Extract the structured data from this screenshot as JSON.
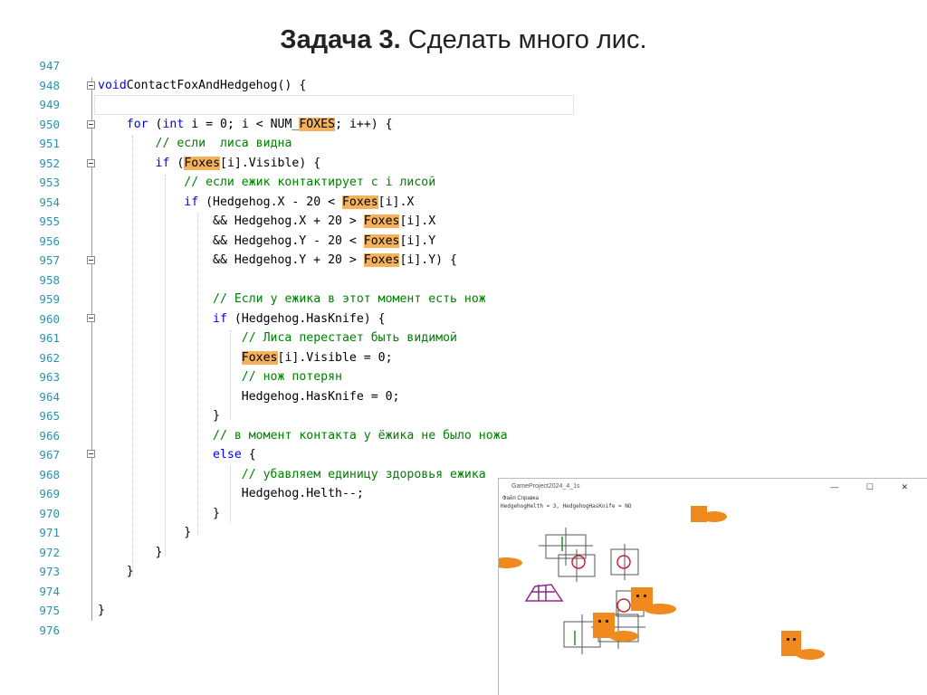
{
  "slide": {
    "title_bold": "Задача 3.",
    "title_rest": " Сделать много лис."
  },
  "editor": {
    "lines": [
      {
        "no": "947",
        "parts": []
      },
      {
        "no": "948",
        "parts": [
          [
            "kw",
            "void"
          ],
          [
            "",
            "ContactFoxAndHedgehog() {"
          ]
        ]
      },
      {
        "no": "949",
        "parts": []
      },
      {
        "no": "950",
        "parts": [
          [
            "",
            "    "
          ],
          [
            "kw",
            "for"
          ],
          [
            "",
            " ("
          ],
          [
            "kw",
            "int"
          ],
          [
            "",
            "",
            " i = 0; i < NUM_"
          ],
          [
            "hl",
            "FOXES"
          ],
          [
            "",
            "; i++) {"
          ]
        ]
      },
      {
        "no": "951",
        "parts": [
          [
            "",
            "        "
          ],
          [
            "cm",
            "// если  лиса видна"
          ]
        ]
      },
      {
        "no": "952",
        "parts": [
          [
            "",
            "        "
          ],
          [
            "kw",
            "if"
          ],
          [
            "",
            "",
            " ("
          ],
          [
            "hl",
            "Foxes"
          ],
          [
            "",
            "[i].Visible) {"
          ]
        ]
      },
      {
        "no": "953",
        "parts": [
          [
            "",
            "            "
          ],
          [
            "cm",
            "// если ежик контактирует с i лисой"
          ]
        ]
      },
      {
        "no": "954",
        "parts": [
          [
            "",
            "            "
          ],
          [
            "kw",
            "if"
          ],
          [
            "",
            "",
            " (Hedgehog.X - 20 < "
          ],
          [
            "hl",
            "Foxes"
          ],
          [
            "",
            "[i].X"
          ]
        ]
      },
      {
        "no": "955",
        "parts": [
          [
            "",
            "                && Hedgehog.X + 20 > "
          ],
          [
            "hl",
            "Foxes"
          ],
          [
            "",
            "[i].X"
          ]
        ]
      },
      {
        "no": "956",
        "parts": [
          [
            "",
            "                && Hedgehog.Y - 20 < "
          ],
          [
            "hl",
            "Foxes"
          ],
          [
            "",
            "[i].Y"
          ]
        ]
      },
      {
        "no": "957",
        "parts": [
          [
            "",
            "                && Hedgehog.Y + 20 > "
          ],
          [
            "hl",
            "Foxes"
          ],
          [
            "",
            "[i].Y) {"
          ]
        ]
      },
      {
        "no": "958",
        "parts": []
      },
      {
        "no": "959",
        "parts": [
          [
            "",
            "                "
          ],
          [
            "cm",
            "// Если у ежика в этот момент есть нож"
          ]
        ]
      },
      {
        "no": "960",
        "parts": [
          [
            "",
            "                "
          ],
          [
            "kw",
            "if"
          ],
          [
            "",
            "",
            " (Hedgehog.HasKnife) {"
          ]
        ]
      },
      {
        "no": "961",
        "parts": [
          [
            "",
            "                    "
          ],
          [
            "cm",
            "// Лиса перестает быть видимой"
          ]
        ]
      },
      {
        "no": "962",
        "parts": [
          [
            "",
            "                    "
          ],
          [
            "hl",
            "Foxes"
          ],
          [
            "",
            "[i].Visible = 0;"
          ]
        ]
      },
      {
        "no": "963",
        "parts": [
          [
            "",
            "                    "
          ],
          [
            "cm",
            "// нож потерян"
          ]
        ]
      },
      {
        "no": "964",
        "parts": [
          [
            "",
            "                    Hedgehog.HasKnife = 0;"
          ]
        ]
      },
      {
        "no": "965",
        "parts": [
          [
            "",
            "                }"
          ]
        ]
      },
      {
        "no": "966",
        "parts": [
          [
            "",
            "                "
          ],
          [
            "cm",
            "// в момент контакта у ёжика не было ножа"
          ]
        ]
      },
      {
        "no": "967",
        "parts": [
          [
            "",
            "                "
          ],
          [
            "kw",
            "else"
          ],
          [
            "",
            "",
            " {"
          ]
        ]
      },
      {
        "no": "968",
        "parts": [
          [
            "",
            "                    "
          ],
          [
            "cm",
            "// убавляем единицу здоровья ежика"
          ]
        ]
      },
      {
        "no": "969",
        "parts": [
          [
            "",
            "                    Hedgehog.Helth--;"
          ]
        ]
      },
      {
        "no": "970",
        "parts": [
          [
            "",
            "                }"
          ]
        ]
      },
      {
        "no": "971",
        "parts": [
          [
            "",
            "            }"
          ]
        ]
      },
      {
        "no": "972",
        "parts": [
          [
            "",
            "        }"
          ]
        ]
      },
      {
        "no": "973",
        "parts": [
          [
            "",
            "    }"
          ]
        ]
      },
      {
        "no": "974",
        "parts": []
      },
      {
        "no": "975",
        "parts": [
          [
            "",
            "}"
          ]
        ]
      },
      {
        "no": "976",
        "parts": []
      }
    ],
    "colors": {
      "keyword": "#0000ff",
      "comment": "#008000",
      "highlight": "#f4b25c",
      "line_number": "#2b91af"
    }
  },
  "game_window": {
    "title": "GameProject2024_4_1s",
    "buttons": "— ☐ ✕",
    "menu": "Файл  Справка",
    "status": "HedgehogHelth = 3, HedgehogHasKnife = NO",
    "colors": {
      "fox": "#f08a1e",
      "hedgehog": "#8b2a8b",
      "marker": "#cc2233"
    }
  }
}
